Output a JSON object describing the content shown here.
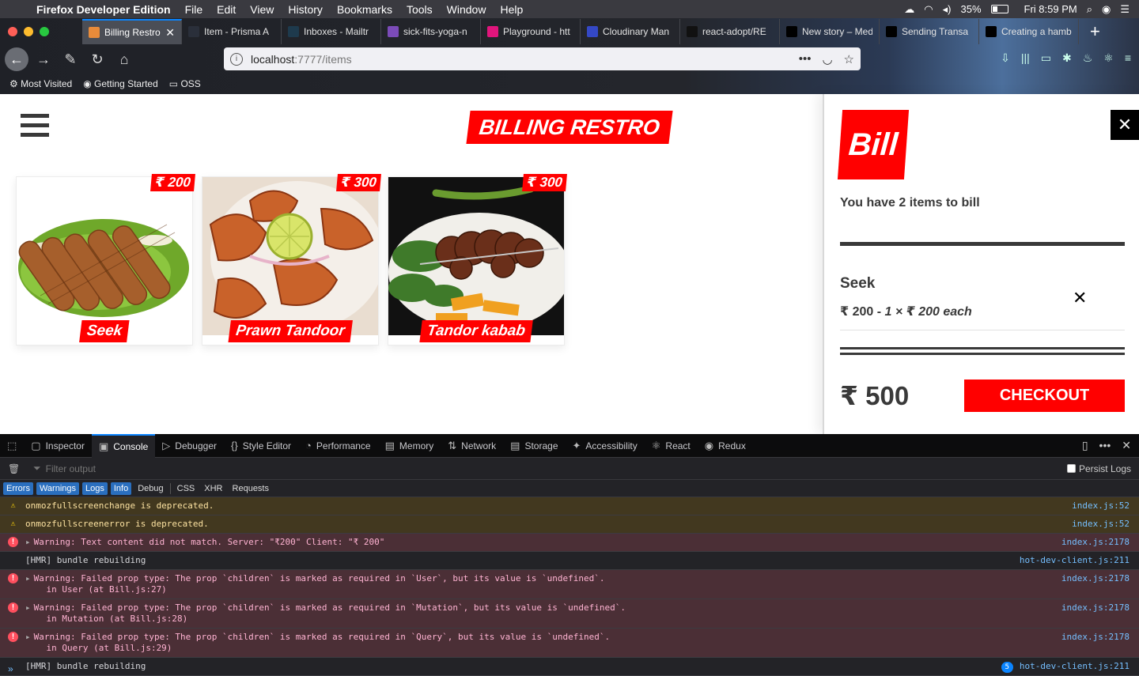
{
  "macos_menubar": {
    "app_name": "Firefox Developer Edition",
    "menus": [
      "File",
      "Edit",
      "View",
      "History",
      "Bookmarks",
      "Tools",
      "Window",
      "Help"
    ],
    "battery": "35%",
    "clock": "Fri 8:59 PM"
  },
  "browser": {
    "tabs": [
      {
        "label": "Billing Restro",
        "icon_color": "#e88b3a",
        "active": true
      },
      {
        "label": "Item - Prisma A",
        "icon_color": "#2a2f3a"
      },
      {
        "label": "Inboxes - Mailtr",
        "icon_color": "#1e3a4d"
      },
      {
        "label": "sick-fits-yoga-n",
        "icon_color": "#7b4bb8"
      },
      {
        "label": "Playground - htt",
        "icon_color": "#e0157c"
      },
      {
        "label": "Cloudinary Man",
        "icon_color": "#3448c5"
      },
      {
        "label": "react-adopt/RE",
        "icon_color": "#111111"
      },
      {
        "label": "New story – Med",
        "icon_color": "#000000"
      },
      {
        "label": "Sending Transa",
        "icon_color": "#000000"
      },
      {
        "label": "Creating a hamb",
        "icon_color": "#000000"
      }
    ],
    "url_host": "localhost",
    "url_path": ":7777/items",
    "bookmarks": [
      "Most Visited",
      "Getting Started",
      "OSS"
    ]
  },
  "app": {
    "logo": "BILLING RESTRO",
    "items": [
      {
        "title": "Seek",
        "price": "₹ 200"
      },
      {
        "title": "Prawn Tandoor",
        "price": "₹ 300"
      },
      {
        "title": "Tandor kabab",
        "price": "₹ 300"
      }
    ]
  },
  "bill": {
    "heading": "Bill",
    "close": "✕",
    "count_text": "You have 2 items to bill",
    "item": {
      "name": "Seek",
      "amount": "₹ 200 - ",
      "detail": "1 × ₹ 200 each",
      "remove": "✕"
    },
    "total": "₹ 500",
    "checkout": "CHECKOUT"
  },
  "devtools": {
    "tabs": [
      {
        "label": "Inspector",
        "glyph": "▢"
      },
      {
        "label": "Console",
        "glyph": "▣",
        "active": true
      },
      {
        "label": "Debugger",
        "glyph": "▷"
      },
      {
        "label": "Style Editor",
        "glyph": "{}"
      },
      {
        "label": "Performance",
        "glyph": "◔"
      },
      {
        "label": "Memory",
        "glyph": "▤"
      },
      {
        "label": "Network",
        "glyph": "⇅"
      },
      {
        "label": "Storage",
        "glyph": "▤"
      },
      {
        "label": "Accessibility",
        "glyph": "✦"
      },
      {
        "label": "React",
        "glyph": "⚛"
      },
      {
        "label": "Redux",
        "glyph": "◉"
      }
    ],
    "filter_placeholder": "Filter output",
    "persist_logs": "Persist Logs",
    "levels": [
      {
        "label": "Errors",
        "on": true
      },
      {
        "label": "Warnings",
        "on": true
      },
      {
        "label": "Logs",
        "on": true
      },
      {
        "label": "Info",
        "on": true
      },
      {
        "label": "Debug",
        "on": false
      },
      {
        "label": "CSS",
        "on": false
      },
      {
        "label": "XHR",
        "on": false
      },
      {
        "label": "Requests",
        "on": false
      }
    ],
    "messages": [
      {
        "type": "warn",
        "text": "onmozfullscreenchange is deprecated.",
        "source": "index.js:52"
      },
      {
        "type": "warn",
        "text": "onmozfullscreenerror is deprecated.",
        "source": "index.js:52"
      },
      {
        "type": "err",
        "text": "Warning: Text content did not match. Server: \"₹200\" Client: \"₹ 200\"",
        "source": "index.js:2178",
        "expandable": true
      },
      {
        "type": "log",
        "text": "[HMR] bundle rebuilding",
        "source": "hot-dev-client.js:211"
      },
      {
        "type": "err",
        "text": "Warning: Failed prop type: The prop `children` is marked as required in `User`, but its value is `undefined`.\n    in User (at Bill.js:27)",
        "source": "index.js:2178",
        "expandable": true
      },
      {
        "type": "err",
        "text": "Warning: Failed prop type: The prop `children` is marked as required in `Mutation`, but its value is `undefined`.\n    in Mutation (at Bill.js:28)",
        "source": "index.js:2178",
        "expandable": true
      },
      {
        "type": "err",
        "text": "Warning: Failed prop type: The prop `children` is marked as required in `Query`, but its value is `undefined`.\n    in Query (at Bill.js:29)",
        "source": "index.js:2178",
        "expandable": true
      },
      {
        "type": "log",
        "text": "[HMR] bundle rebuilding",
        "source": "hot-dev-client.js:211",
        "repeat": "5"
      }
    ],
    "prompt": "»"
  }
}
